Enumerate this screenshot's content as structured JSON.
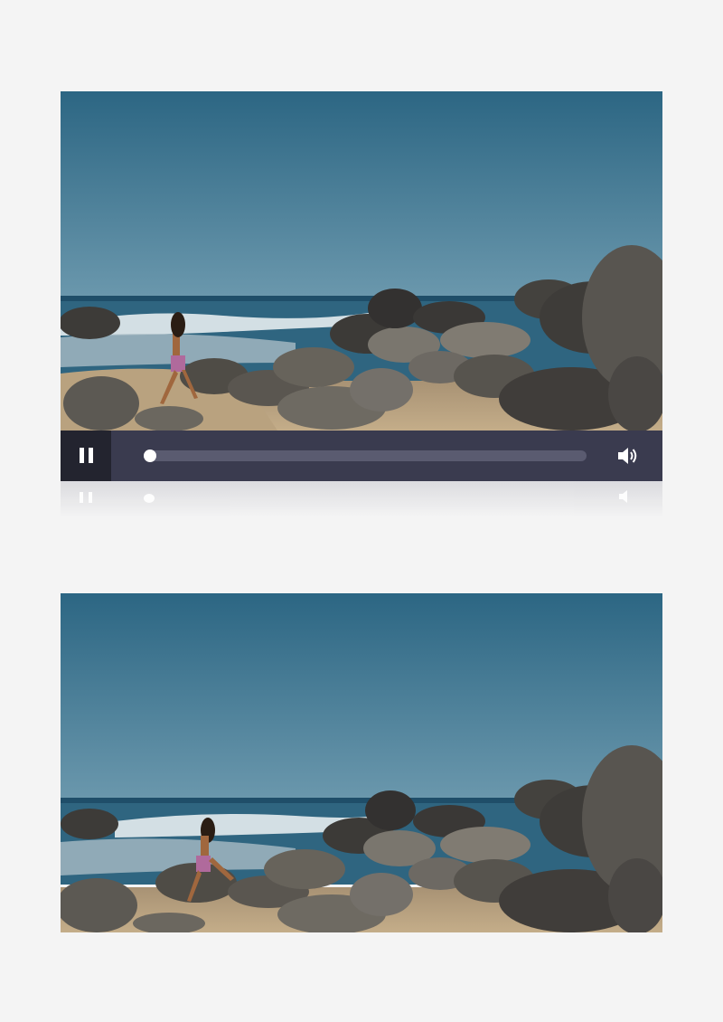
{
  "player": {
    "state": "playing",
    "progress": 0.0,
    "controls": {
      "play_pause_icon": "pause-icon",
      "volume_icon": "volume-icon"
    }
  },
  "frames": [
    {
      "name": "video-frame-1",
      "scene": "beach-rocks-person-walking"
    },
    {
      "name": "video-frame-2",
      "scene": "beach-rocks-person-climbing"
    }
  ],
  "colors": {
    "sky_top": "#2e6a86",
    "sky_bottom": "#5e90a8",
    "ocean": "#2b5f7a",
    "sand": "#b9a27f",
    "rock": "#55524c",
    "controls_bg": "#3a3b4f",
    "button_bg": "#23242f",
    "track": "#5a5b70"
  }
}
